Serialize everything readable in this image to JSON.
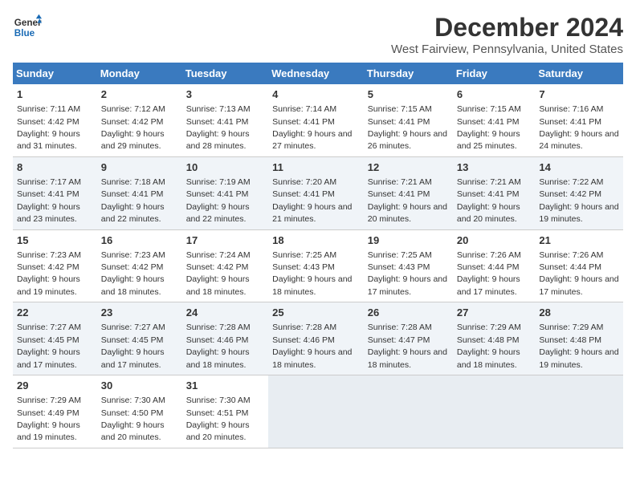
{
  "header": {
    "logo_line1": "General",
    "logo_line2": "Blue",
    "title": "December 2024",
    "subtitle": "West Fairview, Pennsylvania, United States"
  },
  "days_of_week": [
    "Sunday",
    "Monday",
    "Tuesday",
    "Wednesday",
    "Thursday",
    "Friday",
    "Saturday"
  ],
  "weeks": [
    [
      {
        "day": "1",
        "sunrise": "7:11 AM",
        "sunset": "4:42 PM",
        "daylight": "9 hours and 31 minutes."
      },
      {
        "day": "2",
        "sunrise": "7:12 AM",
        "sunset": "4:42 PM",
        "daylight": "9 hours and 29 minutes."
      },
      {
        "day": "3",
        "sunrise": "7:13 AM",
        "sunset": "4:41 PM",
        "daylight": "9 hours and 28 minutes."
      },
      {
        "day": "4",
        "sunrise": "7:14 AM",
        "sunset": "4:41 PM",
        "daylight": "9 hours and 27 minutes."
      },
      {
        "day": "5",
        "sunrise": "7:15 AM",
        "sunset": "4:41 PM",
        "daylight": "9 hours and 26 minutes."
      },
      {
        "day": "6",
        "sunrise": "7:15 AM",
        "sunset": "4:41 PM",
        "daylight": "9 hours and 25 minutes."
      },
      {
        "day": "7",
        "sunrise": "7:16 AM",
        "sunset": "4:41 PM",
        "daylight": "9 hours and 24 minutes."
      }
    ],
    [
      {
        "day": "8",
        "sunrise": "7:17 AM",
        "sunset": "4:41 PM",
        "daylight": "9 hours and 23 minutes."
      },
      {
        "day": "9",
        "sunrise": "7:18 AM",
        "sunset": "4:41 PM",
        "daylight": "9 hours and 22 minutes."
      },
      {
        "day": "10",
        "sunrise": "7:19 AM",
        "sunset": "4:41 PM",
        "daylight": "9 hours and 22 minutes."
      },
      {
        "day": "11",
        "sunrise": "7:20 AM",
        "sunset": "4:41 PM",
        "daylight": "9 hours and 21 minutes."
      },
      {
        "day": "12",
        "sunrise": "7:21 AM",
        "sunset": "4:41 PM",
        "daylight": "9 hours and 20 minutes."
      },
      {
        "day": "13",
        "sunrise": "7:21 AM",
        "sunset": "4:41 PM",
        "daylight": "9 hours and 20 minutes."
      },
      {
        "day": "14",
        "sunrise": "7:22 AM",
        "sunset": "4:42 PM",
        "daylight": "9 hours and 19 minutes."
      }
    ],
    [
      {
        "day": "15",
        "sunrise": "7:23 AM",
        "sunset": "4:42 PM",
        "daylight": "9 hours and 19 minutes."
      },
      {
        "day": "16",
        "sunrise": "7:23 AM",
        "sunset": "4:42 PM",
        "daylight": "9 hours and 18 minutes."
      },
      {
        "day": "17",
        "sunrise": "7:24 AM",
        "sunset": "4:42 PM",
        "daylight": "9 hours and 18 minutes."
      },
      {
        "day": "18",
        "sunrise": "7:25 AM",
        "sunset": "4:43 PM",
        "daylight": "9 hours and 18 minutes."
      },
      {
        "day": "19",
        "sunrise": "7:25 AM",
        "sunset": "4:43 PM",
        "daylight": "9 hours and 17 minutes."
      },
      {
        "day": "20",
        "sunrise": "7:26 AM",
        "sunset": "4:44 PM",
        "daylight": "9 hours and 17 minutes."
      },
      {
        "day": "21",
        "sunrise": "7:26 AM",
        "sunset": "4:44 PM",
        "daylight": "9 hours and 17 minutes."
      }
    ],
    [
      {
        "day": "22",
        "sunrise": "7:27 AM",
        "sunset": "4:45 PM",
        "daylight": "9 hours and 17 minutes."
      },
      {
        "day": "23",
        "sunrise": "7:27 AM",
        "sunset": "4:45 PM",
        "daylight": "9 hours and 17 minutes."
      },
      {
        "day": "24",
        "sunrise": "7:28 AM",
        "sunset": "4:46 PM",
        "daylight": "9 hours and 18 minutes."
      },
      {
        "day": "25",
        "sunrise": "7:28 AM",
        "sunset": "4:46 PM",
        "daylight": "9 hours and 18 minutes."
      },
      {
        "day": "26",
        "sunrise": "7:28 AM",
        "sunset": "4:47 PM",
        "daylight": "9 hours and 18 minutes."
      },
      {
        "day": "27",
        "sunrise": "7:29 AM",
        "sunset": "4:48 PM",
        "daylight": "9 hours and 18 minutes."
      },
      {
        "day": "28",
        "sunrise": "7:29 AM",
        "sunset": "4:48 PM",
        "daylight": "9 hours and 19 minutes."
      }
    ],
    [
      {
        "day": "29",
        "sunrise": "7:29 AM",
        "sunset": "4:49 PM",
        "daylight": "9 hours and 19 minutes."
      },
      {
        "day": "30",
        "sunrise": "7:30 AM",
        "sunset": "4:50 PM",
        "daylight": "9 hours and 20 minutes."
      },
      {
        "day": "31",
        "sunrise": "7:30 AM",
        "sunset": "4:51 PM",
        "daylight": "9 hours and 20 minutes."
      },
      null,
      null,
      null,
      null
    ]
  ],
  "labels": {
    "sunrise": "Sunrise:",
    "sunset": "Sunset:",
    "daylight": "Daylight:"
  }
}
